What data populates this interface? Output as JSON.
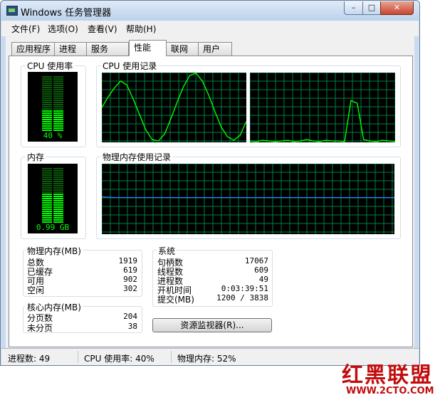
{
  "window": {
    "title": "Windows 任务管理器",
    "controls": {
      "minimize": "–",
      "maximize": "□",
      "close": "✕"
    }
  },
  "menu": [
    "文件(F)",
    "选项(O)",
    "查看(V)",
    "帮助(H)"
  ],
  "tabs": [
    {
      "label": "应用程序",
      "active": false
    },
    {
      "label": "进程",
      "active": false
    },
    {
      "label": "服务",
      "active": false
    },
    {
      "label": "性能",
      "active": true
    },
    {
      "label": "联网",
      "active": false
    },
    {
      "label": "用户",
      "active": false
    }
  ],
  "cpu": {
    "usage_title": "CPU 使用率",
    "usage_percent": 40,
    "usage_text": "40 %",
    "history_title": "CPU 使用记录",
    "history_core1": [
      50,
      65,
      78,
      88,
      82,
      62,
      40,
      18,
      4,
      2,
      12,
      34,
      58,
      80,
      96,
      99,
      88,
      68,
      44,
      22,
      8,
      3,
      10,
      30
    ],
    "history_core2": [
      2,
      1,
      3,
      2,
      1,
      2,
      3,
      1,
      2,
      4,
      2,
      1,
      3,
      2,
      2,
      1,
      60,
      56,
      4,
      2,
      1,
      3,
      2,
      1
    ]
  },
  "memory": {
    "title": "内存",
    "usage_text": "0.99 GB",
    "usage_percent": 52,
    "history_title": "物理内存使用记录",
    "history": [
      53,
      52,
      52,
      52,
      52,
      52,
      52,
      52,
      52,
      52,
      52,
      52,
      52,
      52,
      52,
      52,
      52,
      52,
      52,
      52,
      52,
      52,
      52,
      52
    ]
  },
  "physical_memory": {
    "title": "物理内存(MB)",
    "rows": [
      {
        "label": "总数",
        "value": "1919"
      },
      {
        "label": "已缓存",
        "value": "619"
      },
      {
        "label": "可用",
        "value": "902"
      },
      {
        "label": "空闲",
        "value": "302"
      }
    ]
  },
  "kernel_memory": {
    "title": "核心内存(MB)",
    "rows": [
      {
        "label": "分页数",
        "value": "204"
      },
      {
        "label": "未分页",
        "value": "38"
      }
    ]
  },
  "system": {
    "title": "系统",
    "rows": [
      {
        "label": "句柄数",
        "value": "17067"
      },
      {
        "label": "线程数",
        "value": "609"
      },
      {
        "label": "进程数",
        "value": "49"
      },
      {
        "label": "开机时间",
        "value": "0:03:39:51"
      },
      {
        "label": "提交(MB)",
        "value": "1200 / 3838"
      }
    ]
  },
  "resource_monitor_button": "资源监视器(R)...",
  "status": {
    "processes": "进程数: 49",
    "cpu": "CPU 使用率: 40%",
    "memory": "物理内存: 52%"
  },
  "watermark": {
    "logo": "红黑联盟",
    "url": "WWW.2CTO.COM"
  },
  "colors": {
    "graph_green": "#00ff00",
    "grid_green": "#008040",
    "mem_line": "#1f7fff"
  }
}
